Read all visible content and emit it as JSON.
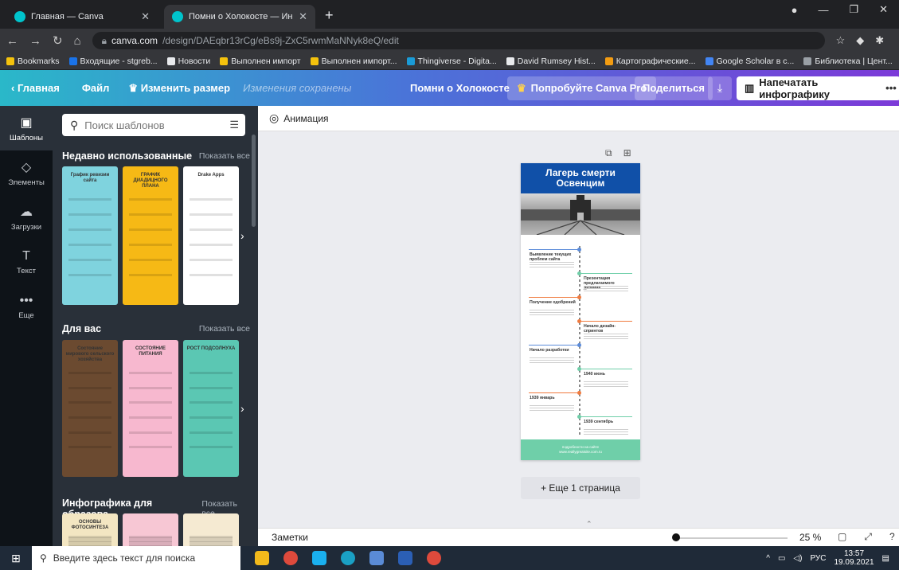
{
  "browser": {
    "tabs": [
      {
        "title": "Главная — Canva",
        "active": false
      },
      {
        "title": "Помни о Холокосте — Инфогр...",
        "active": true
      }
    ],
    "new_tab": "+",
    "url_host": "canva.com",
    "url_path": "/design/DAEqbr13rCg/eBs9j-ZxC5rwmMaNNyk8eQ/edit",
    "bookmarks": [
      {
        "label": "Bookmarks",
        "color": "#f4c20d"
      },
      {
        "label": "Входящие - stgreb...",
        "color": "#1a73e8"
      },
      {
        "label": "Новости",
        "color": "#e8eaed"
      },
      {
        "label": "Выполнен импорт",
        "color": "#f4c20d"
      },
      {
        "label": "Выполнен импорт...",
        "color": "#f4c20d"
      },
      {
        "label": "Thingiverse - Digita...",
        "color": "#1a9bd7"
      },
      {
        "label": "David Rumsey Hist...",
        "color": "#e8eaed"
      },
      {
        "label": "Картографические...",
        "color": "#f39c12"
      },
      {
        "label": "Google Scholar в с...",
        "color": "#4285f4"
      },
      {
        "label": "Библиотека | Цент...",
        "color": "#9aa0a6"
      }
    ]
  },
  "canva_bar": {
    "home": "Главная",
    "file": "Файл",
    "resize": "Изменить размер",
    "saved": "Изменения сохранены",
    "doc_title": "Помни о Холокосте",
    "try_pro": "Попробуйте Canva Pro",
    "share": "Поделиться",
    "print": "Напечатать инфографику",
    "more": "•••"
  },
  "rail": [
    {
      "label": "Шаблоны",
      "icon": "▣"
    },
    {
      "label": "Элементы",
      "icon": "◇"
    },
    {
      "label": "Загрузки",
      "icon": "☁"
    },
    {
      "label": "Текст",
      "icon": "T"
    },
    {
      "label": "Еще",
      "icon": "•••"
    }
  ],
  "panel": {
    "search_placeholder": "Поиск шаблонов",
    "sections": [
      {
        "title": "Недавно использованные",
        "show_all": "Показать все"
      },
      {
        "title": "Для вас",
        "show_all": "Показать все"
      },
      {
        "title": "Инфографика для образова...",
        "show_all": "Показать все"
      }
    ],
    "recent_thumbs": [
      {
        "title": "График ревизии сайта",
        "bg": "#7fd3de"
      },
      {
        "title": "ГРАФИК ДИАДИЦНОГО ПЛАНА",
        "bg": "#f6b915"
      },
      {
        "title": "Drake Apps",
        "bg": "#ffffff"
      }
    ],
    "foryou_thumbs": [
      {
        "title": "Состояние мирового сельского хозяйства",
        "bg": "#6b4a30"
      },
      {
        "title": "СОСТОЯНИЕ ПИТАНИЯ",
        "bg": "#f7b8cf"
      },
      {
        "title": "РОСТ ПОДСОЛНУХА",
        "bg": "#5bc7b3"
      }
    ],
    "edu_thumbs": [
      {
        "title": "ОСНОВЫ ФОТОСИНТЕЗА",
        "bg": "#f3e6c2"
      },
      {
        "title": "",
        "bg": "#f7c7d4"
      },
      {
        "title": "",
        "bg": "#f5ead2"
      }
    ]
  },
  "editor": {
    "animation": "Анимация",
    "add_page": "+ Еще 1 страница",
    "page": {
      "title": "Лагерь смерти Освенцим",
      "items": [
        {
          "label": "Выявление текущих проблем сайта",
          "side": "left",
          "color": "#5b8bd9"
        },
        {
          "label": "Презентация предлагаемого дизайна",
          "side": "right",
          "color": "#6fcfa9"
        },
        {
          "label": "Получение одобрений",
          "side": "left",
          "color": "#f07b3f"
        },
        {
          "label": "Начало дизайн-спринтов",
          "side": "right",
          "color": "#f07b3f"
        },
        {
          "label": "Начало разработки",
          "side": "left",
          "color": "#5b8bd9"
        },
        {
          "label": "1940 июнь",
          "side": "right",
          "color": "#6fcfa9"
        },
        {
          "label": "1939 январь",
          "side": "left",
          "color": "#f07b3f"
        },
        {
          "label": "1939 сентябрь",
          "side": "right",
          "color": "#6fcfa9"
        }
      ],
      "footer_line1": "подробности на сайте",
      "footer_line2": "www.reallygreatsite.com.ru"
    }
  },
  "bottom": {
    "notes": "Заметки",
    "zoom": "25 %",
    "zoom_fraction": 0.25
  },
  "taskbar": {
    "search_placeholder": "Введите здесь текст для поиска",
    "lang": "РУС",
    "time": "13:57",
    "date": "19.09.2021"
  }
}
